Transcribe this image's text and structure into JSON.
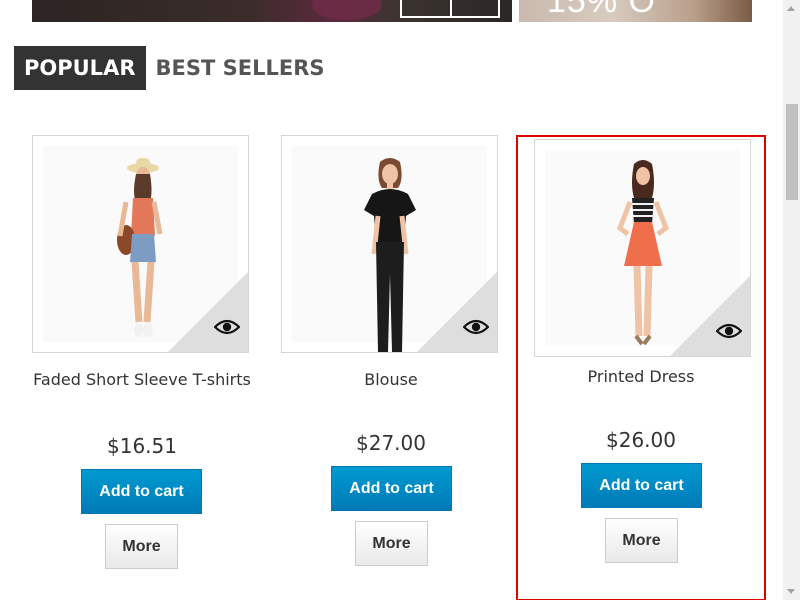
{
  "banners": {
    "right_promo_text": "15% O"
  },
  "tabs": [
    {
      "label": "POPULAR",
      "active": true
    },
    {
      "label": "BEST SELLERS",
      "active": false
    }
  ],
  "products": [
    {
      "name": "Faded Short Sleeve T-shirts",
      "price": "$16.51",
      "add_to_cart_label": "Add to cart",
      "more_label": "More"
    },
    {
      "name": "Blouse",
      "price": "$27.00",
      "add_to_cart_label": "Add to cart",
      "more_label": "More"
    },
    {
      "name": "Printed Dress",
      "price": "$26.00",
      "add_to_cart_label": "Add to cart",
      "more_label": "More",
      "highlighted": true
    }
  ],
  "icons": {
    "quick_view": "eye-icon"
  },
  "colors": {
    "tab_active_bg": "#333333",
    "button_blue": "#0088c4",
    "highlight_border": "#e00000"
  }
}
